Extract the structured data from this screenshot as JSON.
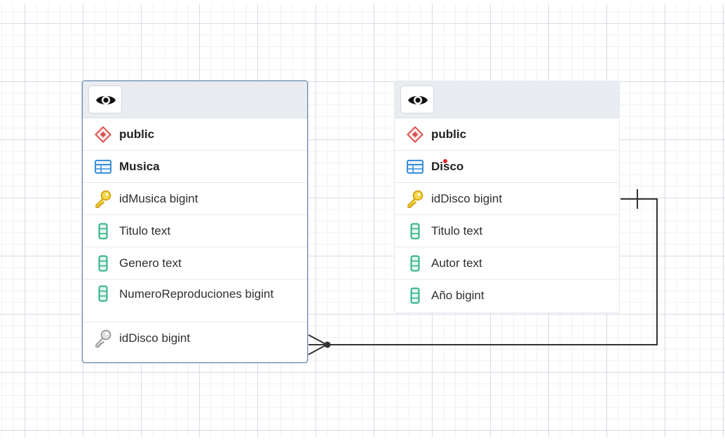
{
  "tables": [
    {
      "schema": "public",
      "name": "Musica",
      "columns": [
        {
          "label": "idMusica bigint",
          "icon": "primary-key-icon"
        },
        {
          "label": "Titulo text",
          "icon": "column-icon"
        },
        {
          "label": "Genero text",
          "icon": "column-icon"
        },
        {
          "label": "NumeroReproduciones bigint",
          "icon": "column-icon"
        },
        {
          "label": "idDisco bigint",
          "icon": "foreign-key-icon"
        }
      ]
    },
    {
      "schema": "public",
      "name": "Disco",
      "columns": [
        {
          "label": "idDisco bigint",
          "icon": "primary-key-icon"
        },
        {
          "label": "Titulo text",
          "icon": "column-icon"
        },
        {
          "label": "Autor text",
          "icon": "column-icon"
        },
        {
          "label": "Año bigint",
          "icon": "column-icon"
        }
      ]
    }
  ],
  "colors": {
    "schema_icon": "#d9534f",
    "table_icon": "#3a8fd9",
    "primary_key": "#e6b800",
    "foreign_key": "#9a9a9a",
    "column_icon": "#2bb089",
    "connector": "#333333"
  },
  "relationship": {
    "from": "Musica.idDisco",
    "to": "Disco.idDisco",
    "from_end": "many",
    "to_end": "one"
  }
}
